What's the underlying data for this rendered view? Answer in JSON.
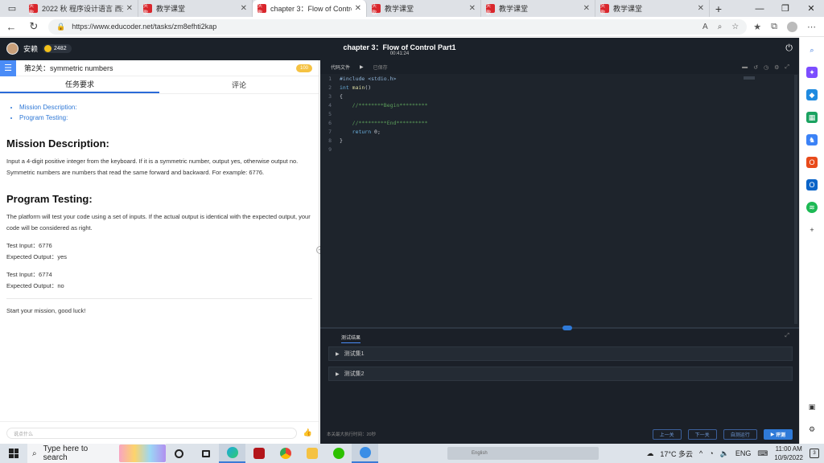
{
  "browser": {
    "tabs": [
      {
        "title": "2022 秋 程序设计语言 西交",
        "fav": "头歌",
        "active": false
      },
      {
        "title": "教学课堂",
        "fav": "头歌",
        "active": false
      },
      {
        "title": "chapter 3：Flow of Control",
        "fav": "头歌",
        "active": true
      },
      {
        "title": "教学课堂",
        "fav": "头歌",
        "active": false
      },
      {
        "title": "教学课堂",
        "fav": "头歌",
        "active": false
      },
      {
        "title": "教学课堂",
        "fav": "头歌",
        "active": false
      }
    ],
    "url": "https://www.educoder.net/tasks/zm8efhti2kap"
  },
  "header": {
    "user": "安赖",
    "coins": "2482",
    "title": "chapter 3：Flow of Control Part1",
    "timer": "00:41:24"
  },
  "task": {
    "level": "第2关：symmetric numbers",
    "score": "100",
    "tabs": [
      "任务要求",
      "评论"
    ],
    "toc": [
      "Mission Description:",
      "Program Testing:"
    ],
    "h_mission": "Mission Description:",
    "mission_text": "Input a 4-digit positive integer from the keyboard. If it is a symmetric number, output yes, otherwise output no. Symmetric numbers are numbers that read the same forward and backward. For example: 6776.",
    "h_testing": "Program Testing:",
    "testing_text": "The platform will test your code using a set of inputs. If the actual output is identical with the expected output, your code will be considered as right.",
    "test1_in": "Test Input：6776",
    "test1_out": "Expected Output：yes",
    "test2_in": "Test Input：6774",
    "test2_out": "Expected Output：no",
    "start": "Start your mission, good luck!",
    "comment_placeholder": "说点什么"
  },
  "editor": {
    "file_tab": "代码文件",
    "saved": "已保存",
    "lines": [
      {
        "n": "1",
        "html": "<span class='pp'>#include &lt;stdio.h&gt;</span>"
      },
      {
        "n": "2",
        "html": "<span class='kw'>int</span> <span class='fn'>main</span>()"
      },
      {
        "n": "3",
        "html": "{"
      },
      {
        "n": "4",
        "html": "    <span class='cm'>//********Begin*********</span>"
      },
      {
        "n": "5",
        "html": ""
      },
      {
        "n": "6",
        "html": "    <span class='cm'>//*********End**********</span>"
      },
      {
        "n": "7",
        "html": "    <span class='kw'>return</span> 0;"
      },
      {
        "n": "8",
        "html": "}"
      },
      {
        "n": "9",
        "html": ""
      }
    ]
  },
  "tests": {
    "tab": "测试结果",
    "cases": [
      "测试集1",
      "测试集2"
    ],
    "footer": "本关最大执行时间：20秒",
    "buttons": {
      "prev": "上一关",
      "next": "下一关",
      "run": "自测运行",
      "eval": "评测"
    }
  },
  "taskbar": {
    "search": "Type here to search",
    "ime": "English",
    "weather": "17°C 多云",
    "lang": "ENG",
    "time": "11:00 AM",
    "date": "10/9/2022",
    "notif_count": "3"
  }
}
